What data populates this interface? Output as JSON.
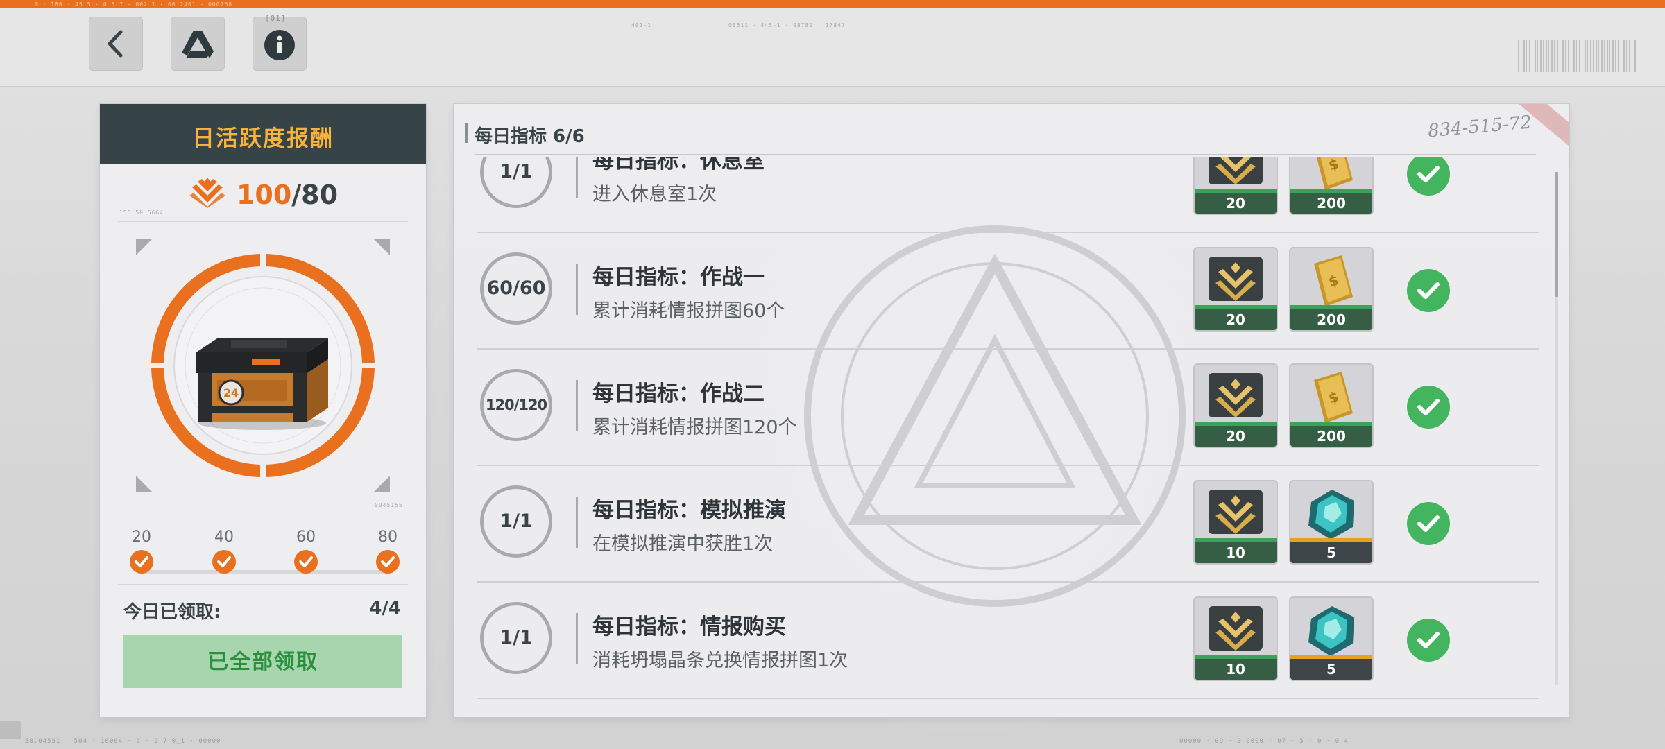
{
  "header": {
    "back_icon": "chevron-left-icon",
    "drive_icon": "triangle-drive-icon",
    "info_icon": "info-icon",
    "info_tag": "[01]"
  },
  "activity_panel": {
    "title": "日活跃度报酬",
    "score_current": "100",
    "score_separator": "/",
    "score_max": "80",
    "score_icon": "activity-chevron-icon",
    "chest_level": "24",
    "milestones": [
      {
        "value": "20",
        "claimed": true
      },
      {
        "value": "40",
        "claimed": true
      },
      {
        "value": "60",
        "claimed": true
      },
      {
        "value": "80",
        "claimed": true
      }
    ],
    "today_label": "今日已领取:",
    "today_value": "4/4",
    "claim_all_label": "已全部领取"
  },
  "tasks_panel": {
    "header": "每日指标 6/6",
    "handwritten_code": "834-515-72",
    "tasks": [
      {
        "progress": "1/1",
        "title": "每日指标：休息室",
        "desc": "进入休息室1次",
        "rewards": [
          {
            "icon": "activity-points-icon",
            "qty": "20",
            "quality": "green"
          },
          {
            "icon": "gold-bar-icon",
            "qty": "200",
            "quality": "green"
          }
        ],
        "completed": true
      },
      {
        "progress": "60/60",
        "title": "每日指标：作战一",
        "desc": "累计消耗情报拼图60个",
        "rewards": [
          {
            "icon": "activity-points-icon",
            "qty": "20",
            "quality": "green"
          },
          {
            "icon": "gold-bar-icon",
            "qty": "200",
            "quality": "green"
          }
        ],
        "completed": true
      },
      {
        "progress": "120/120",
        "title": "每日指标：作战二",
        "desc": "累计消耗情报拼图120个",
        "rewards": [
          {
            "icon": "activity-points-icon",
            "qty": "20",
            "quality": "green"
          },
          {
            "icon": "gold-bar-icon",
            "qty": "200",
            "quality": "green"
          }
        ],
        "completed": true
      },
      {
        "progress": "1/1",
        "title": "每日指标：模拟推演",
        "desc": "在模拟推演中获胜1次",
        "rewards": [
          {
            "icon": "activity-points-icon",
            "qty": "10",
            "quality": "green"
          },
          {
            "icon": "crystal-icon",
            "qty": "5",
            "quality": "gold"
          }
        ],
        "completed": true
      },
      {
        "progress": "1/1",
        "title": "每日指标：情报购买",
        "desc": "消耗坍塌晶条兑换情报拼图1次",
        "rewards": [
          {
            "icon": "activity-points-icon",
            "qty": "10",
            "quality": "green"
          },
          {
            "icon": "crystal-icon",
            "qty": "5",
            "quality": "gold"
          }
        ],
        "completed": true
      }
    ]
  },
  "colors": {
    "accent_orange": "#e8701f",
    "title_gold": "#f7b23b",
    "complete_green": "#43b55e",
    "claim_green_bg": "#a7d6ae",
    "claim_green_text": "#2c8f3d"
  }
}
